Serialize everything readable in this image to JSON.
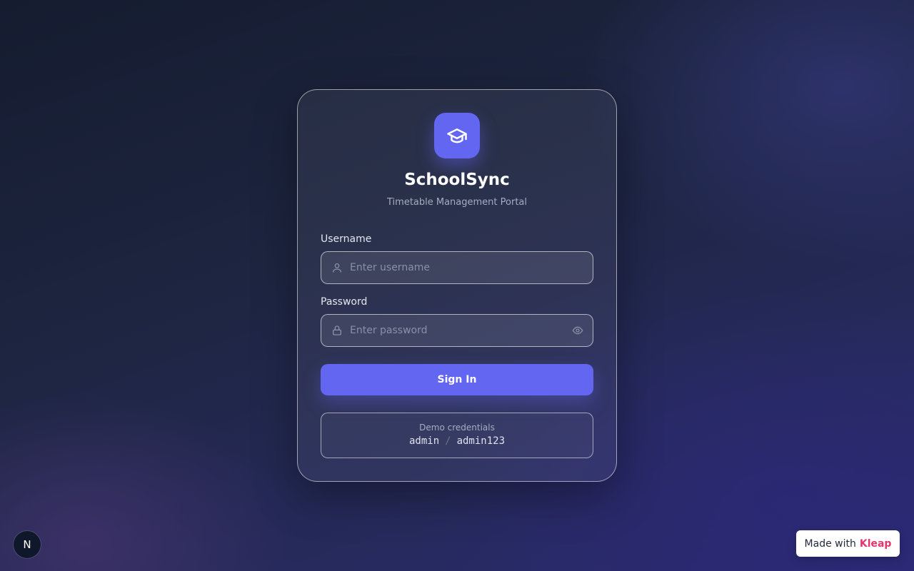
{
  "app": {
    "title": "SchoolSync",
    "subtitle": "Timetable Management Portal",
    "logo_icon": "graduation-cap-icon",
    "accent_color": "#6366f1"
  },
  "form": {
    "username": {
      "label": "Username",
      "placeholder": "Enter username",
      "value": "",
      "icon": "user-icon"
    },
    "password": {
      "label": "Password",
      "placeholder": "Enter password",
      "value": "",
      "icon": "lock-icon",
      "toggle_icon": "eye-icon"
    },
    "submit_label": "Sign In"
  },
  "demo": {
    "title": "Demo credentials",
    "username": "admin",
    "separator": "/",
    "password": "admin123"
  },
  "footer": {
    "badge_letter": "N",
    "made_with": "Made with",
    "brand": "Kleap",
    "brand_color": "#e6336b"
  }
}
